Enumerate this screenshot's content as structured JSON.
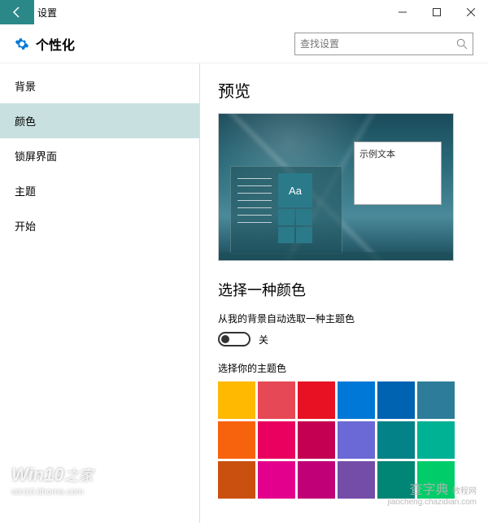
{
  "titlebar": {
    "title": "设置"
  },
  "header": {
    "page_title": "个性化",
    "search_placeholder": "查找设置"
  },
  "sidebar": {
    "items": [
      {
        "label": "背景"
      },
      {
        "label": "颜色"
      },
      {
        "label": "锁屏界面"
      },
      {
        "label": "主题"
      },
      {
        "label": "开始"
      }
    ],
    "active_index": 1
  },
  "content": {
    "preview_heading": "预览",
    "preview_sample_text": "示例文本",
    "preview_tile_text": "Aa",
    "choose_color_heading": "选择一种颜色",
    "auto_pick_label": "从我的背景自动选取一种主题色",
    "toggle_state": "关",
    "accent_label": "选择你的主题色",
    "colors": [
      "#ffb900",
      "#e74856",
      "#e81123",
      "#0078d7",
      "#0063b1",
      "#2d7d9a",
      "#f7630c",
      "#ea005e",
      "#c30052",
      "#6b69d6",
      "#038387",
      "#00b294",
      "#ca5010",
      "#e3008c",
      "#bf0077",
      "#744da9",
      "#018574",
      "#00cc6a"
    ]
  },
  "watermarks": {
    "w1_main": "Win10",
    "w1_suffix": "之家",
    "w1_url": "win10.ithome.com",
    "w2_main": "查字典",
    "w2_url": "jiaocheng.chazidian.com",
    "w2_suffix": "教程网"
  }
}
